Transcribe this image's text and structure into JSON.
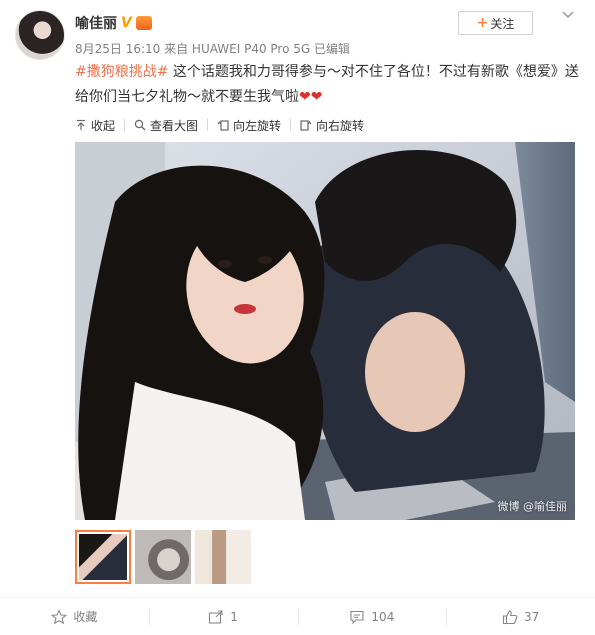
{
  "post": {
    "author": "喻佳丽",
    "verified_icon": "V",
    "follow_label": "关注",
    "follow_plus": "+",
    "meta": "8月25日 16:10 来自 HUAWEI P40 Pro 5G   已编辑",
    "topic": "#撒狗粮挑战#",
    "body": " 这个话题我和力哥得参与～对不住了各位！不过有新歌《想爱》送给你们当七夕礼物～就不要生我气啦",
    "hearts": "❤❤",
    "watermark": "微博 @喻佳丽"
  },
  "toolbar": {
    "collapse": "收起",
    "view_large": "查看大图",
    "rotate_left": "向左旋转",
    "rotate_right": "向右旋转"
  },
  "footer": {
    "favorite": "收藏",
    "repost_count": "1",
    "comment_count": "104",
    "like_count": "37"
  },
  "colors": {
    "accent": "#eb7350",
    "follow_plus": "#ff8140",
    "thumb_border": "#fa7d3c"
  },
  "icons": [
    "collapse-arrow-icon",
    "zoom-icon",
    "rotate-left-icon",
    "rotate-right-icon",
    "star-icon",
    "share-icon",
    "comment-icon",
    "thumbs-up-icon",
    "chevron-down-icon"
  ]
}
